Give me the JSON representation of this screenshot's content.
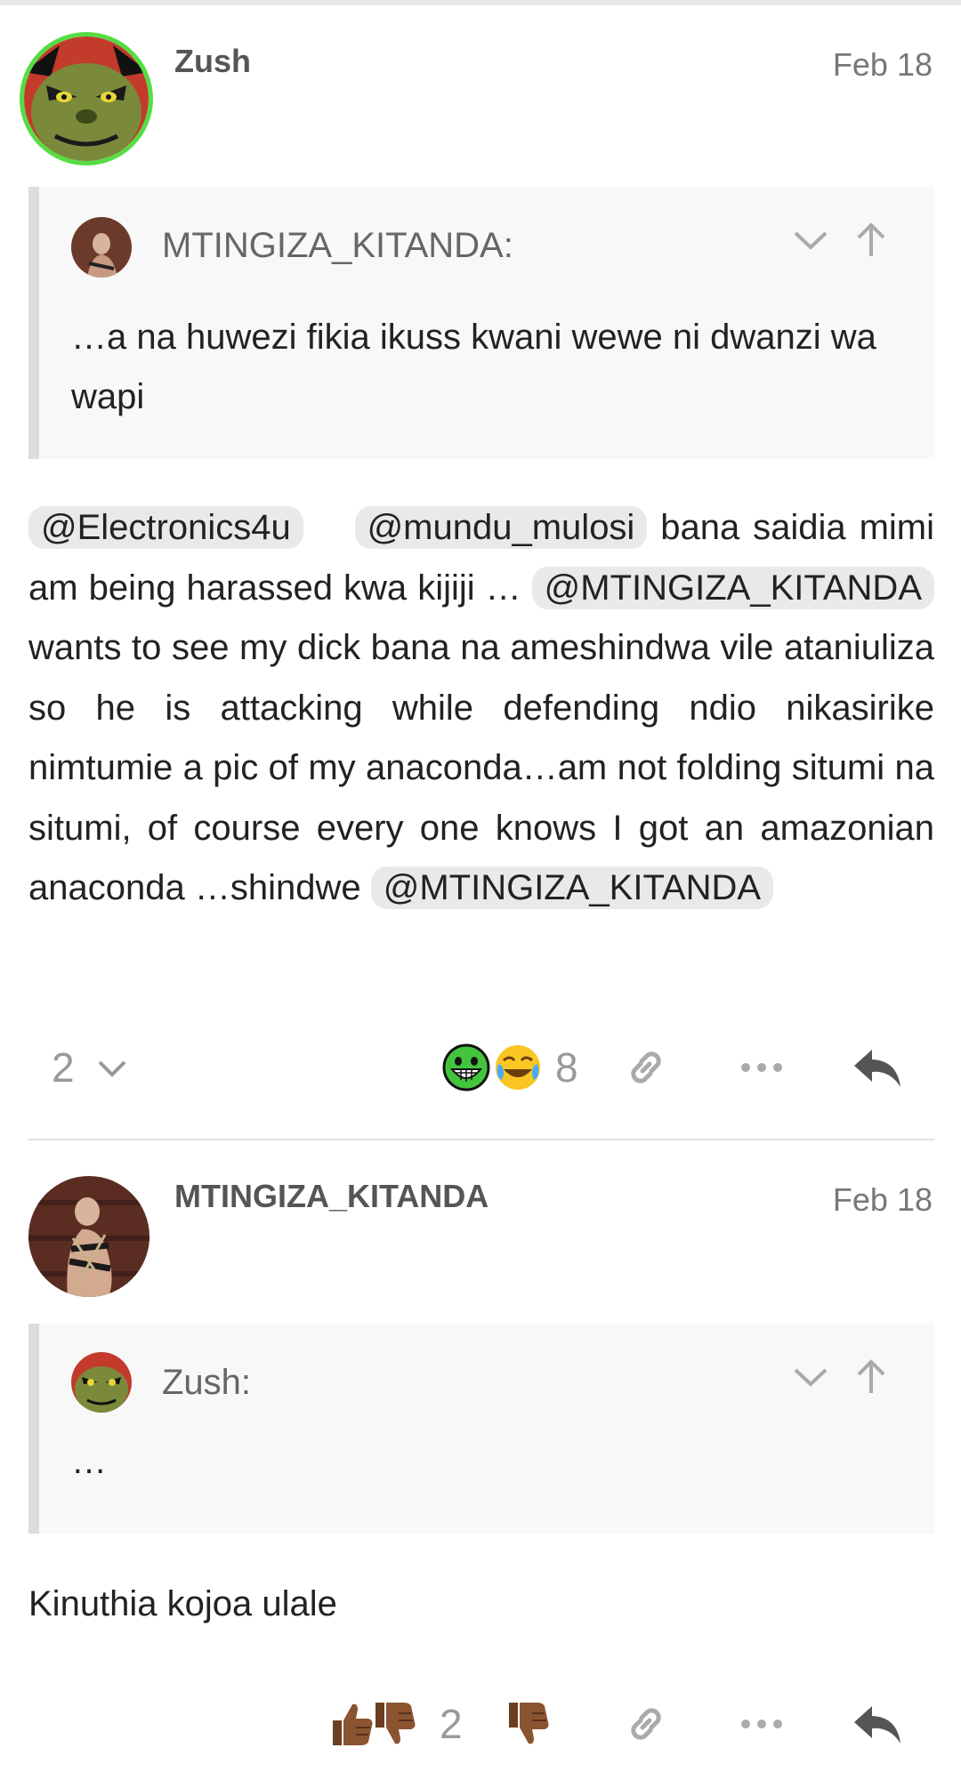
{
  "posts": [
    {
      "username": "Zush",
      "date": "Feb 18",
      "quote": {
        "username": "MTINGIZA_KITANDA:",
        "text": "…a na huwezi fikia ikuss kwani wewe ni dwanzi wa wapi"
      },
      "body": {
        "mention1": "@Electronics4u",
        "mention2": "@mundu_mulosi",
        "text1": " bana saidia mimi am being harassed kwa kijiji … ",
        "mention3": "@MTINGIZA_KITANDA",
        "text2": " wants to see my dick bana na ameshindwa vile ataniuliza so he is attacking while defending ndio nikasirike nimtumie a pic of my anaconda…am not folding situmi na situmi, of course every one knows I got an amazonian anaconda …shindwe ",
        "mention4": "@MTINGIZA_KITANDA"
      },
      "replies_count": "2",
      "reactions": {
        "emojis": [
          "grinning-face-with-big-eyes-emoji",
          "face-with-tears-of-joy-emoji"
        ],
        "count": "8"
      }
    },
    {
      "username": "MTINGIZA_KITANDA",
      "date": "Feb 18",
      "quote": {
        "username": "Zush:",
        "text": "…"
      },
      "body": {
        "text": "Kinuthia kojoa ulale"
      },
      "reactions": {
        "emojis": [
          "thumbs-up-emoji",
          "thumbs-down-emoji"
        ],
        "count": "2"
      }
    }
  ],
  "colors": {
    "avatar_ring": "#55dd44",
    "mention_bg": "#e9e9e9",
    "quote_bg": "#f8f8f8",
    "quote_border": "#dddddd",
    "icon_grey": "#999999",
    "reply_icon": "#555555"
  }
}
